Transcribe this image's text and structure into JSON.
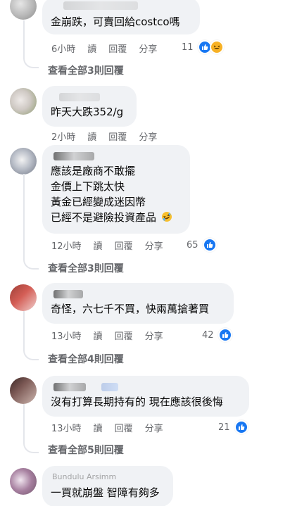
{
  "comments": [
    {
      "author": "",
      "body": [
        "金崩跌，可賣回給costco嗎"
      ],
      "meta": {
        "time": "6小時",
        "read": "讀",
        "reply": "回覆",
        "share": "分享"
      },
      "reaction_count": "11",
      "reaction_icons": [
        "like-icon",
        "haha-icon"
      ],
      "view_replies": "查看全部3則回覆"
    },
    {
      "author": "",
      "body": [
        "昨天大跌352/g"
      ],
      "meta": {
        "time": "2小時",
        "read": "讀",
        "reply": "回覆",
        "share": "分享"
      }
    },
    {
      "author": "",
      "body": [
        "應該是廠商不敢擺",
        "金價上下跳太快",
        "黃金已經變成迷因幣",
        "已經不是避險投資產品"
      ],
      "inline_emoji": "rofl-emoji",
      "meta": {
        "time": "12小時",
        "read": "讀",
        "reply": "回覆",
        "share": "分享"
      },
      "reaction_count": "65",
      "reaction_icons": [
        "like-icon"
      ],
      "view_replies": "查看全部3則回覆"
    },
    {
      "author": "",
      "body": [
        "奇怪，六七千不買，快兩萬搶著買"
      ],
      "meta": {
        "time": "13小時",
        "read": "讀",
        "reply": "回覆",
        "share": "分享"
      },
      "reaction_count": "42",
      "reaction_icons": [
        "like-icon"
      ],
      "view_replies": "查看全部4則回覆"
    },
    {
      "author": "",
      "body": [
        "沒有打算長期持有的 現在應該很後悔"
      ],
      "meta": {
        "time": "13小時",
        "read": "讀",
        "reply": "回覆",
        "share": "分享"
      },
      "reaction_count": "21",
      "reaction_icons": [
        "like-icon"
      ],
      "view_replies": "查看全部5則回覆"
    },
    {
      "author": "Bundulu Arsimm",
      "body": [
        "一買就崩盤 智障有夠多"
      ]
    }
  ],
  "colors": {
    "bubble": "#f0f2f5",
    "text": "#050505",
    "meta": "#65676b",
    "like": "#1877f2",
    "haha": "#f7b125",
    "thread": "#e4e6eb"
  }
}
